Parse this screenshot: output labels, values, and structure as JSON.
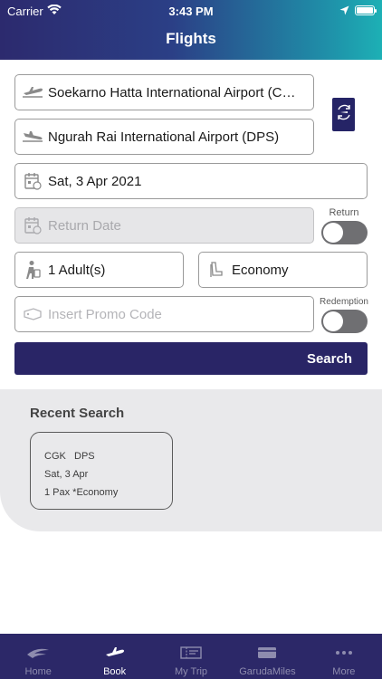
{
  "status_bar": {
    "carrier": "Carrier",
    "time": "3:43 PM"
  },
  "header": {
    "title": "Flights"
  },
  "form": {
    "origin": "Soekarno Hatta International Airport (CGK)",
    "destination": "Ngurah Rai International Airport (DPS)",
    "depart_date": "Sat, 3 Apr 2021",
    "return_date_placeholder": "Return Date",
    "return_label": "Return",
    "passengers": "1 Adult(s)",
    "cabin_class": "Economy",
    "promo_placeholder": "Insert Promo Code",
    "redemption_label": "Redemption",
    "search_label": "Search"
  },
  "recent_search": {
    "title": "Recent Search",
    "items": [
      {
        "route": "CGK   DPS",
        "date": "Sat, 3 Apr",
        "details": "1 Pax *Economy"
      }
    ]
  },
  "tabs": [
    {
      "label": "Home",
      "icon": "garuda-logo-icon",
      "active": false
    },
    {
      "label": "Book",
      "icon": "plane-icon",
      "active": true
    },
    {
      "label": "My Trip",
      "icon": "ticket-icon",
      "active": false
    },
    {
      "label": "GarudaMiles",
      "icon": "card-icon",
      "active": false
    },
    {
      "label": "More",
      "icon": "more-dots-icon",
      "active": false
    }
  ],
  "colors": {
    "header_start": "#2c2a6e",
    "header_end": "#1db0b5",
    "primary": "#292566",
    "tab_inactive": "#8e8cae"
  }
}
